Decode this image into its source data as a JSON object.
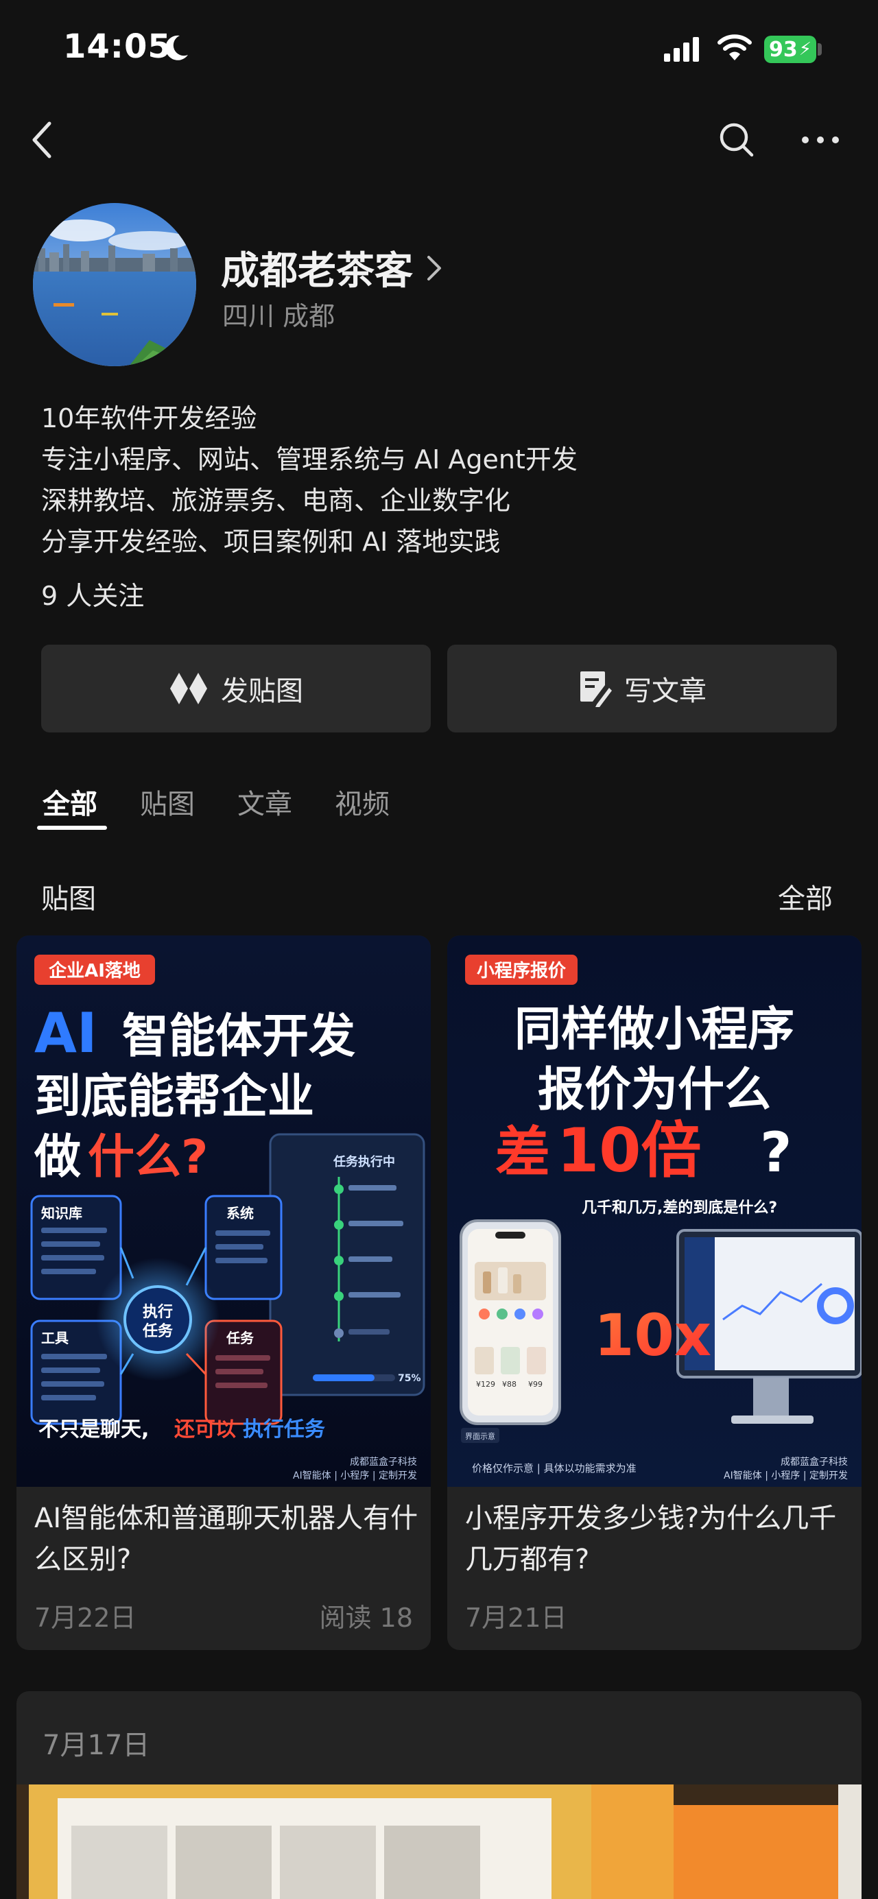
{
  "status_bar": {
    "time": "14:05",
    "battery": "93"
  },
  "profile": {
    "name": "成都老茶客",
    "location": "四川 成都",
    "bio": [
      "10年软件开发经验",
      "专注小程序、网站、管理系统与 AI Agent开发",
      "深耕教培、旅游票务、电商、企业数字化",
      "分享开发经验、项目案例和 AI 落地实践"
    ],
    "followers": "9 人关注"
  },
  "actions": {
    "post_image": "发贴图",
    "write_article": "写文章"
  },
  "tabs": [
    {
      "label": "全部",
      "active": true
    },
    {
      "label": "贴图",
      "active": false
    },
    {
      "label": "文章",
      "active": false
    },
    {
      "label": "视频",
      "active": false
    }
  ],
  "section": {
    "title": "贴图",
    "all": "全部"
  },
  "posts": [
    {
      "title": "AI智能体和普通聊天机器人有什么区别?",
      "date": "7月22日",
      "reads": "阅读 18",
      "cover": {
        "tag": "企业AI落地",
        "line1a": "AI",
        "line1b": "智能体开发",
        "line2": "到底能帮企业",
        "line3a": "做",
        "line3b": "什么?",
        "box_kb": "知识库",
        "box_sys": "系统",
        "box_tool": "工具",
        "box_task": "任务",
        "center": "执行",
        "center2": "任务",
        "panel_title": "任务执行中",
        "progress": "75%",
        "tagline_a": "不只是聊天,",
        "tagline_b": "还可以",
        "tagline_c": "执行任务",
        "brand": "成都蓝盒子科技",
        "brand_sub": "AI智能体 | 小程序 | 定制开发"
      }
    },
    {
      "title": "小程序开发多少钱?为什么几千几万都有?",
      "date": "7月21日",
      "reads": "",
      "cover": {
        "tag": "小程序报价",
        "line1": "同样做小程序",
        "line2": "报价为什么",
        "line3a": "差",
        "line3b": "10倍",
        "line3c": "?",
        "sub": "几千和几万,差的到底是什么?",
        "big": "10x",
        "note": "界面示意",
        "disclaimer": "价格仅作示意 | 具体以功能需求为准",
        "brand": "成都蓝盒子科技",
        "brand_sub": "AI智能体 | 小程序 | 定制开发",
        "phone_price1": "¥129",
        "phone_price2": "¥88",
        "phone_price3": "¥99"
      }
    }
  ],
  "article": {
    "date": "7月17日"
  },
  "colors": {
    "background": "#121212",
    "card": "#232323",
    "button": "#2a2a2a",
    "accent_red": "#e8402f",
    "accent_blue": "#2f7bff",
    "battery": "#34c759"
  },
  "icons": [
    "moon-icon",
    "signal-icon",
    "wifi-icon",
    "back-icon",
    "search-icon",
    "more-icon",
    "chevron-right-icon",
    "image-post-icon",
    "article-icon"
  ]
}
